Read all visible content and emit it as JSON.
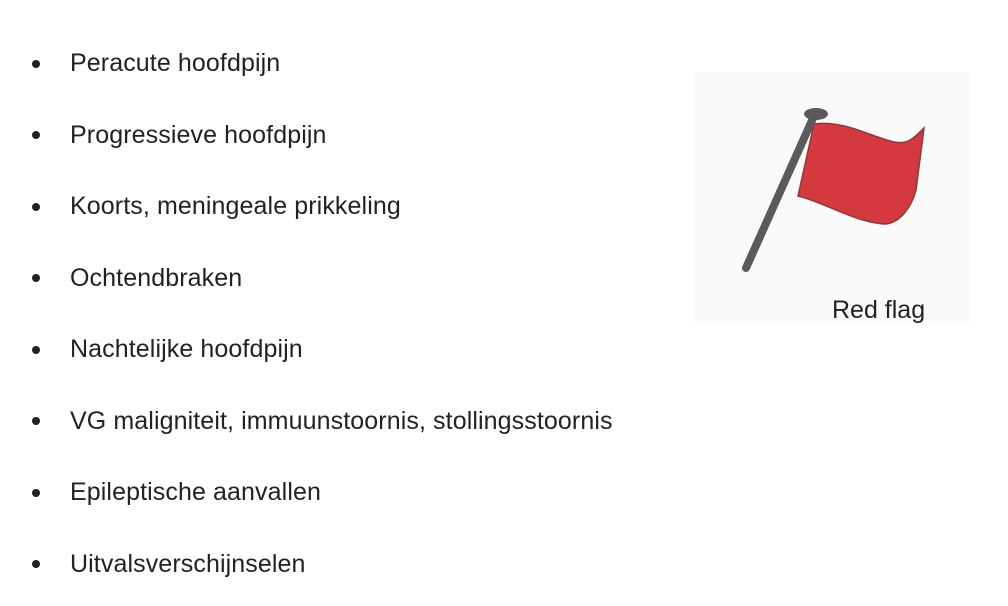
{
  "list": {
    "items": [
      "Peracute hoofdpijn",
      "Progressieve hoofdpijn",
      "Koorts, meningeale prikkeling",
      "Ochtendbraken",
      "Nachtelijke hoofdpijn",
      "VG maligniteit, immuunstoornis, stollingsstoornis",
      "Epileptische aanvallen",
      "Uitvalsverschijnselen"
    ]
  },
  "illustration": {
    "caption": "Red flag",
    "icon": "red-flag-drawing",
    "flag_color": "#d4393f",
    "pole_color": "#5a5a5a"
  }
}
